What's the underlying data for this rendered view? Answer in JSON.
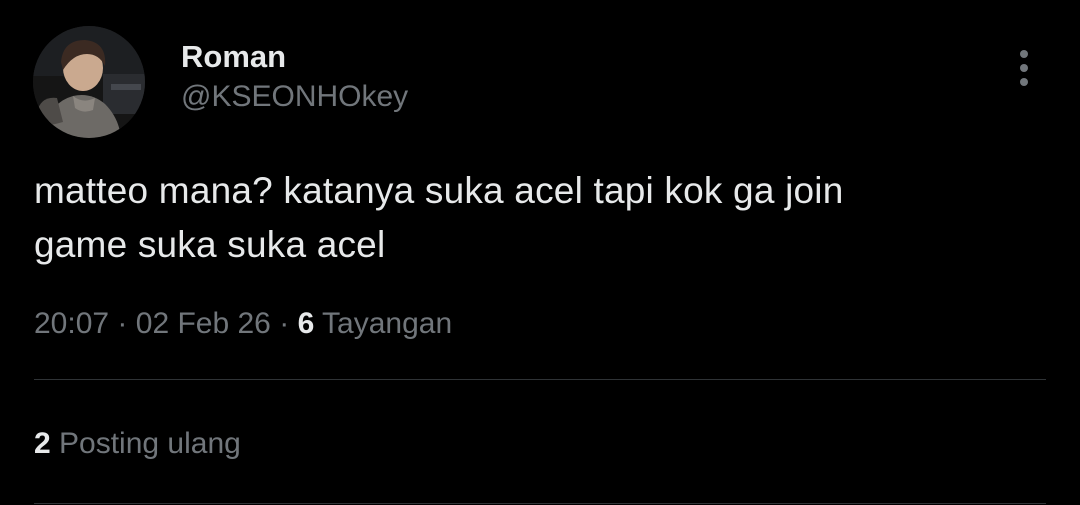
{
  "author": {
    "display_name": "Roman",
    "handle": "@KSEONHOkey"
  },
  "tweet": {
    "text_lines": [
      "matteo mana? katanya suka acel tapi kok ga join",
      "game suka suka acel"
    ],
    "time": "20:07",
    "separator": "·",
    "date": "02 Feb 26",
    "views_count": "6",
    "views_label": "Tayangan"
  },
  "stats": {
    "repost_count": "2",
    "repost_label": "Posting ulang"
  },
  "colors": {
    "background": "#000000",
    "primary_text": "#e7e9ea",
    "secondary_text": "#71767b",
    "divider": "#2f3336"
  },
  "icons": {
    "more": "more-vertical-icon"
  }
}
